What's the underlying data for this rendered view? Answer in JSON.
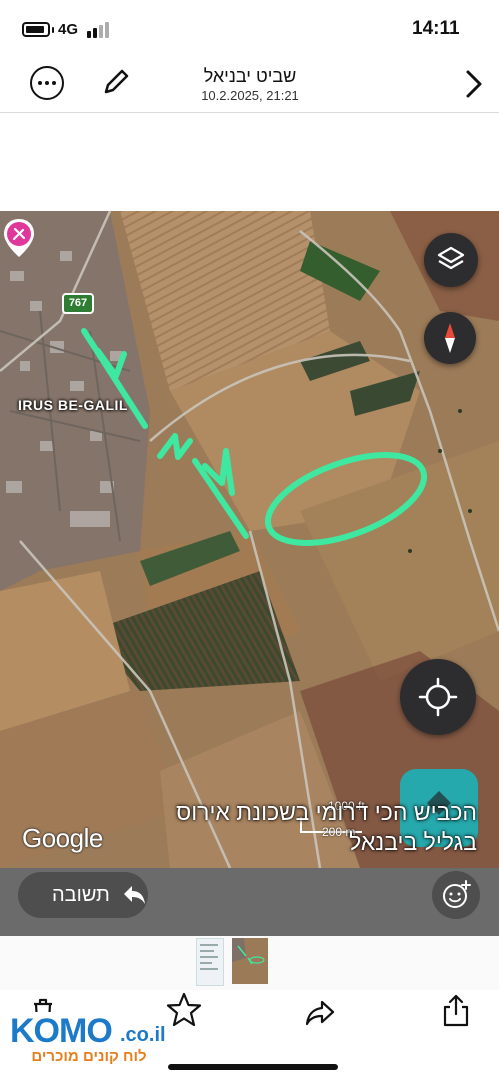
{
  "status_bar": {
    "network": "4G",
    "time": "14:11"
  },
  "header": {
    "title": "שביט יבניאל",
    "subtitle": "10.2.2025, 21:21"
  },
  "map": {
    "town_label": "IRUS BE-GALIL",
    "road_number": "767",
    "attribution": "Google",
    "scale_ft": "1000 ft",
    "scale_m": "200 m",
    "caption_line1": "הכביש הכי דרומי בשכונת אירוס",
    "caption_line2": "בגליל ביבנאל"
  },
  "reply_bar": {
    "reply_label": "תשובה"
  },
  "brand": {
    "name": "KOMO",
    "domain": ".co.il",
    "tagline": "לוח קונים מוכרים"
  },
  "colors": {
    "annotation": "#3ee8a0",
    "brand_blue": "#1c7ac8",
    "teal": "#1fb0b6",
    "pin": "#e0389a"
  },
  "icons": [
    "more-icon",
    "pencil-icon",
    "chevron-right-icon",
    "layers-icon",
    "compass-icon",
    "location-icon",
    "reply-arrow-icon",
    "emoji-add-icon",
    "trash-icon",
    "star-icon",
    "share-icon",
    "upload-icon"
  ]
}
